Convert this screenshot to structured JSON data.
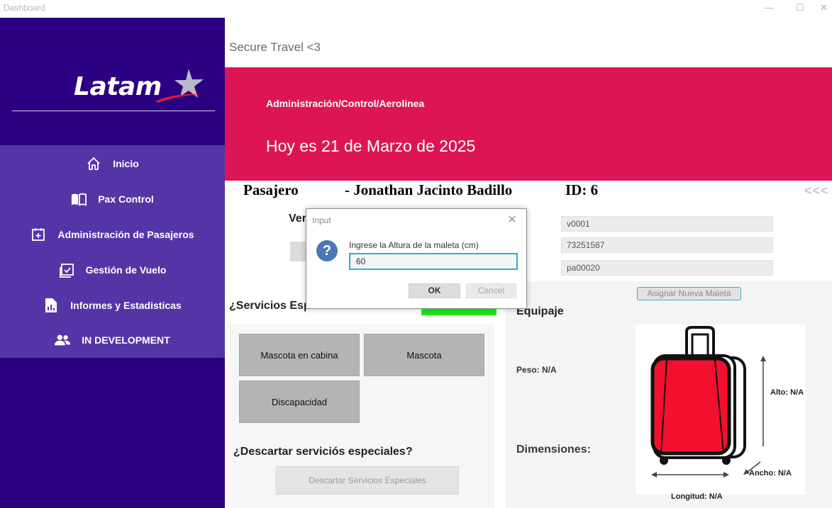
{
  "window": {
    "title": "Dashboard",
    "minimize_glyph": "—",
    "maximize_glyph": "☐",
    "close_glyph": "✕"
  },
  "sidebar": {
    "logo_text": "Latam",
    "items": [
      {
        "label": "Inicio",
        "icon": "home-icon"
      },
      {
        "label": "Pax Control",
        "icon": "book-icon"
      },
      {
        "label": "Administración de Pasajeros",
        "icon": "calendar-plus-icon"
      },
      {
        "label": "Gestión de Vuelo",
        "icon": "calendar-check-icon"
      },
      {
        "label": "Informes y Estadisticas",
        "icon": "report-icon"
      },
      {
        "label": "IN DEVELOPMENT",
        "icon": "users-icon"
      }
    ],
    "colors": {
      "background": "#2b0082",
      "nav_background": "#5535a6"
    }
  },
  "header": {
    "app_subtitle": "Secure Travel <3",
    "breadcrumb": "Administración/Control/Aerolinea",
    "date_text": "Hoy es 21 de Marzo de 2025",
    "banner_color": "#de1554"
  },
  "passenger": {
    "label": "Pasajero",
    "name": "-  Jonathan Jacinto Badillo",
    "id_text": "ID: 6",
    "collapse_text": "<<<"
  },
  "verification": {
    "label_partial": "Ver"
  },
  "fields": {
    "vuelo_code": "v0001",
    "document_number": "73251587",
    "passenger_code": "pa00020"
  },
  "services": {
    "title": "¿Servicios Especiales?",
    "tiles": [
      "Mascota en cabina",
      "Mascota",
      "Discapacidad"
    ],
    "discard_title": "¿Descartar serviciós especiales?",
    "discard_button": "Descartar Servicios Especiales"
  },
  "luggage": {
    "assign_button": "Asignar Nueva Maleta",
    "title": "Equipaje",
    "peso": "Peso: N/A",
    "dimensiones": "Dimensiones:",
    "alto": "Alto: N/A",
    "ancho": "Ancho: N/A",
    "longitud": "Longitud: N/A",
    "suitcase_color": "#f2102e"
  },
  "dialog": {
    "title": "Input",
    "prompt": "Ingrese la Altura de la maleta (cm)",
    "value": "60",
    "ok_label": "OK",
    "cancel_label": "Cancel",
    "icon": "question-icon",
    "icon_glyph": "?",
    "close_glyph": "✕"
  }
}
